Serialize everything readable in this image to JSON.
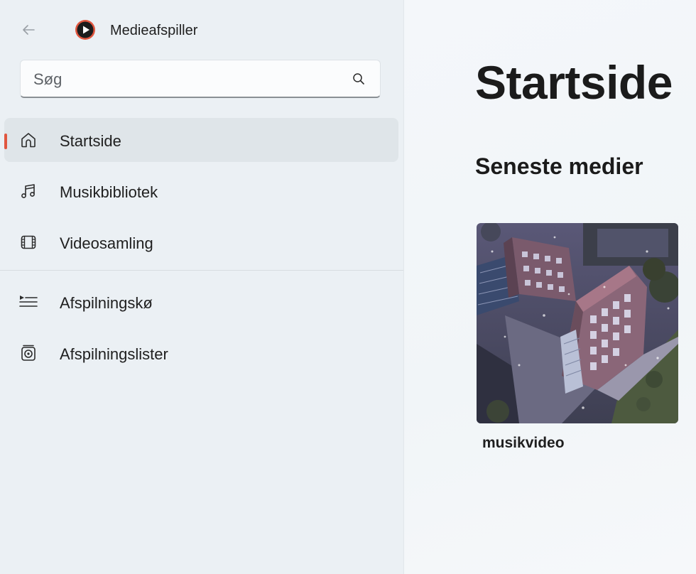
{
  "app": {
    "title": "Medieafspiller",
    "back_icon": "arrow-left-icon",
    "app_icon": "media-player-play-icon",
    "accent_color": "#e0563f"
  },
  "search": {
    "placeholder": "Søg",
    "value": "",
    "icon": "search-icon"
  },
  "nav": {
    "items": [
      {
        "label": "Startside",
        "icon": "home-icon",
        "selected": true
      },
      {
        "label": "Musikbibliotek",
        "icon": "music-note-icon",
        "selected": false
      },
      {
        "label": "Videosamling",
        "icon": "film-icon",
        "selected": false
      }
    ],
    "secondary": [
      {
        "label": "Afspilningskø",
        "icon": "queue-icon"
      },
      {
        "label": "Afspilningslister",
        "icon": "playlist-icon"
      }
    ]
  },
  "main": {
    "title": "Startside",
    "section_title": "Seneste medier",
    "recent": [
      {
        "label": "musikvideo",
        "thumbnail": "aerial-city-buildings-thumbnail"
      }
    ]
  }
}
